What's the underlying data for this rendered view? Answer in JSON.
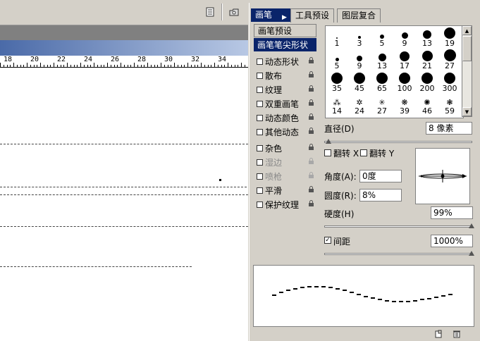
{
  "toolbar": {
    "icons": [
      "document-icon",
      "file-browser-icon"
    ]
  },
  "ruler": {
    "labels": [
      "18",
      "20",
      "22",
      "24",
      "26",
      "28",
      "30",
      "32",
      "34"
    ]
  },
  "palette": {
    "tabs": [
      {
        "label": "画笔",
        "active": true
      },
      {
        "label": "工具预设",
        "active": false
      },
      {
        "label": "图层复合",
        "active": false
      }
    ],
    "options": [
      {
        "label": "画笔预设",
        "type": "header"
      },
      {
        "label": "画笔笔尖形状",
        "type": "selected"
      },
      {
        "label": "动态形状",
        "checked": false,
        "lock": true
      },
      {
        "label": "散布",
        "checked": false,
        "lock": true
      },
      {
        "label": "纹理",
        "checked": false,
        "lock": true
      },
      {
        "label": "双重画笔",
        "checked": false,
        "lock": true
      },
      {
        "label": "动态颜色",
        "checked": false,
        "lock": true
      },
      {
        "label": "其他动态",
        "checked": false,
        "lock": true
      },
      {
        "label": "杂色",
        "checked": false,
        "lock": true
      },
      {
        "label": "湿边",
        "checked": false,
        "lock": true,
        "disabled": true
      },
      {
        "label": "喷枪",
        "checked": false,
        "lock": true,
        "disabled": true
      },
      {
        "label": "平滑",
        "checked": false,
        "lock": true
      },
      {
        "label": "保护纹理",
        "checked": false,
        "lock": true
      }
    ],
    "brushes": [
      {
        "size": "1",
        "dot": 2
      },
      {
        "size": "3",
        "dot": 4
      },
      {
        "size": "5",
        "dot": 6
      },
      {
        "size": "9",
        "dot": 9
      },
      {
        "size": "13",
        "dot": 12
      },
      {
        "size": "19",
        "dot": 16
      },
      {
        "size": "5",
        "dot": 5
      },
      {
        "size": "9",
        "dot": 8
      },
      {
        "size": "13",
        "dot": 11
      },
      {
        "size": "17",
        "dot": 14
      },
      {
        "size": "21",
        "dot": 15
      },
      {
        "size": "27",
        "dot": 17
      },
      {
        "size": "35",
        "dot": 16
      },
      {
        "size": "45",
        "dot": 16
      },
      {
        "size": "65",
        "dot": 16
      },
      {
        "size": "100",
        "dot": 16
      },
      {
        "size": "200",
        "dot": 16
      },
      {
        "size": "300",
        "dot": 16
      },
      {
        "size": "14",
        "dot": 0
      },
      {
        "size": "24",
        "dot": 0
      },
      {
        "size": "27",
        "dot": 0
      },
      {
        "size": "39",
        "dot": 0
      },
      {
        "size": "46",
        "dot": 0
      },
      {
        "size": "59",
        "dot": 0
      }
    ],
    "diameter_label": "直径(D)",
    "diameter_value": "8 像素",
    "flip_x_label": "翻转 X",
    "flip_y_label": "翻转 Y",
    "angle_label": "角度(A):",
    "angle_value": "0度",
    "roundness_label": "圆度(R):",
    "roundness_value": "8%",
    "hardness_label": "硬度(H)",
    "hardness_value": "99%",
    "spacing_label": "间距",
    "spacing_checked": true,
    "spacing_value": "1000%",
    "footer_icons": [
      "new-brush-icon",
      "trash-icon"
    ]
  }
}
